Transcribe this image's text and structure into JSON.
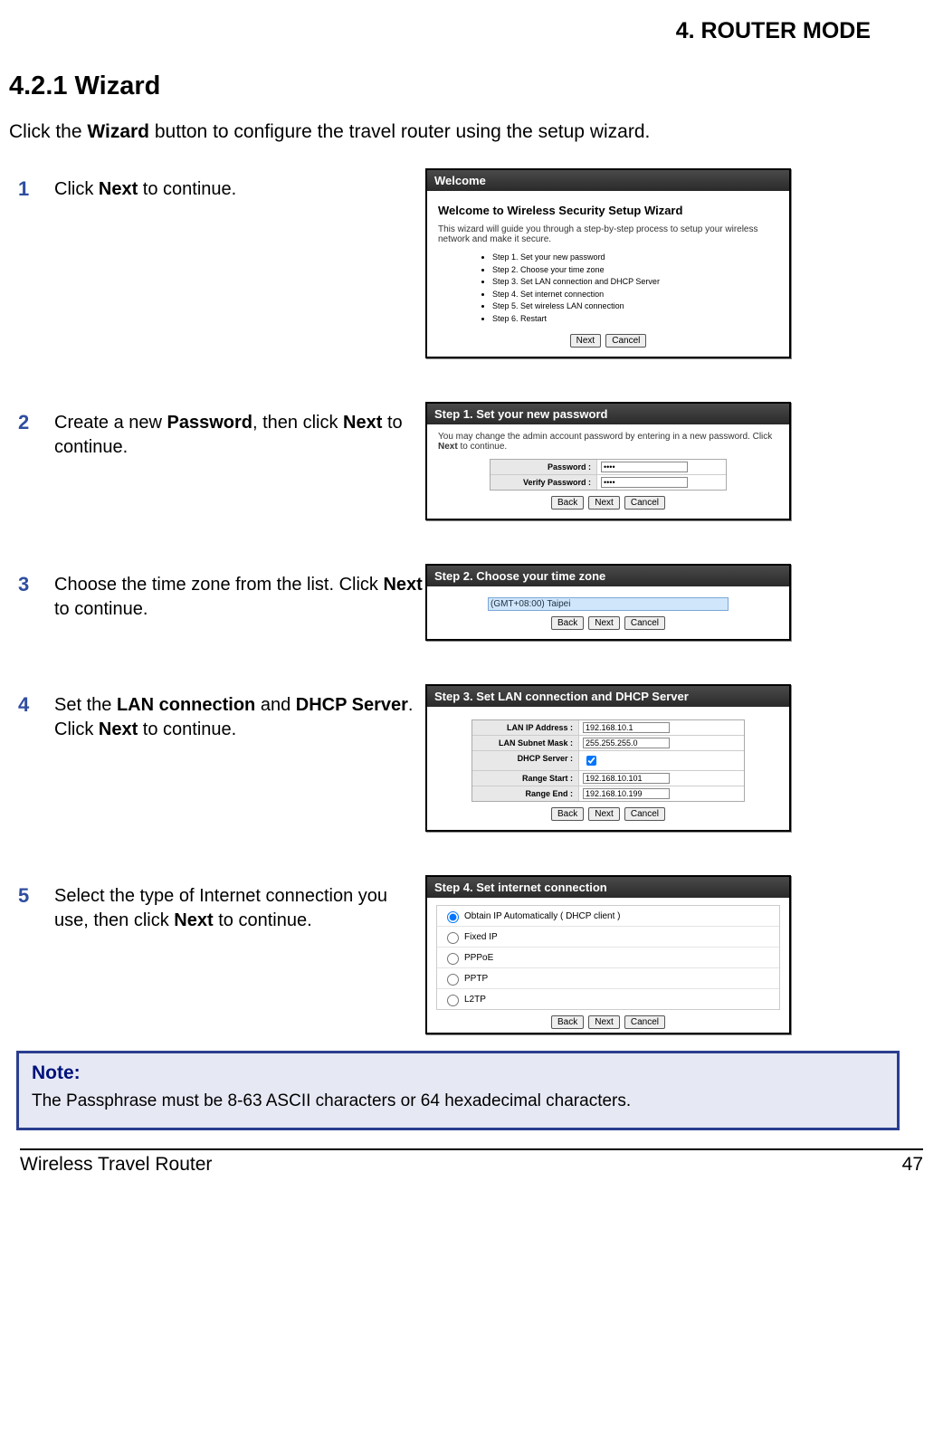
{
  "header": {
    "chapter": "4.  ROUTER MODE"
  },
  "section": {
    "title": "4.2.1 Wizard"
  },
  "intro": {
    "pre": "Click the ",
    "bold": "Wizard",
    "post": " button to configure the travel router using the setup wizard."
  },
  "steps": [
    {
      "num": "1",
      "desc_pre": "Click ",
      "desc_b1": "Next",
      "desc_post": " to continue.",
      "shot": {
        "title": "Welcome",
        "heading": "Welcome to Wireless Security Setup Wizard",
        "sub_pre": "This wizard will guide you through a step-by-step process to setup your wireless network and make it secure.",
        "bullets": [
          "Step 1. Set your new password",
          "Step 2. Choose your time zone",
          "Step 3. Set LAN connection and DHCP Server",
          "Step 4. Set internet connection",
          "Step 5. Set wireless LAN connection",
          "Step 6. Restart"
        ],
        "buttons": [
          "Next",
          "Cancel"
        ]
      }
    },
    {
      "num": "2",
      "desc_pre": "Create a new ",
      "desc_b1": "Password",
      "desc_mid": ", then click ",
      "desc_b2": "Next",
      "desc_post": " to continue.",
      "shot": {
        "title": "Step 1. Set your new password",
        "sub_pre": "You may change the admin account password by entering in a new password. Click",
        "sub_b": "Next",
        "sub_post": " to continue.",
        "fields": [
          {
            "label": "Password :",
            "value": "••••"
          },
          {
            "label": "Verify Password :",
            "value": "••••"
          }
        ],
        "buttons": [
          "Back",
          "Next",
          "Cancel"
        ]
      }
    },
    {
      "num": "3",
      "desc_pre": "Choose the time zone from the list. Click ",
      "desc_b1": "Next",
      "desc_post": " to continue.",
      "shot": {
        "title": "Step 2. Choose your time zone",
        "select": "(GMT+08:00) Taipei",
        "buttons": [
          "Back",
          "Next",
          "Cancel"
        ]
      }
    },
    {
      "num": "4",
      "desc_pre": "Set the ",
      "desc_b1": "LAN connection",
      "desc_mid": " and ",
      "desc_b2": "DHCP Server",
      "desc_mid2": ". Click ",
      "desc_b3": "Next",
      "desc_post": " to continue.",
      "shot": {
        "title": "Step 3. Set LAN connection and DHCP Server",
        "fields": [
          {
            "label": "LAN IP Address :",
            "value": "192.168.10.1"
          },
          {
            "label": "LAN Subnet Mask :",
            "value": "255.255.255.0"
          },
          {
            "label": "DHCP Server :",
            "checkbox": true
          },
          {
            "label": "Range Start :",
            "value": "192.168.10.101"
          },
          {
            "label": "Range End :",
            "value": "192.168.10.199"
          }
        ],
        "buttons": [
          "Back",
          "Next",
          "Cancel"
        ]
      }
    },
    {
      "num": "5",
      "desc_pre": "Select the type of Internet connection you use, then click ",
      "desc_b1": "Next",
      "desc_post": " to continue.",
      "shot": {
        "title": "Step 4. Set internet connection",
        "radios": [
          {
            "label": "Obtain IP Automatically ( DHCP client )",
            "checked": true
          },
          {
            "label": "Fixed IP",
            "checked": false
          },
          {
            "label": "PPPoE",
            "checked": false
          },
          {
            "label": "PPTP",
            "checked": false
          },
          {
            "label": "L2TP",
            "checked": false
          }
        ],
        "buttons": [
          "Back",
          "Next",
          "Cancel"
        ]
      }
    }
  ],
  "note": {
    "title": "Note:",
    "body": "The Passphrase must be 8-63 ASCII characters or 64 hexadecimal characters."
  },
  "footer": {
    "left": "Wireless Travel Router",
    "right": "47"
  }
}
